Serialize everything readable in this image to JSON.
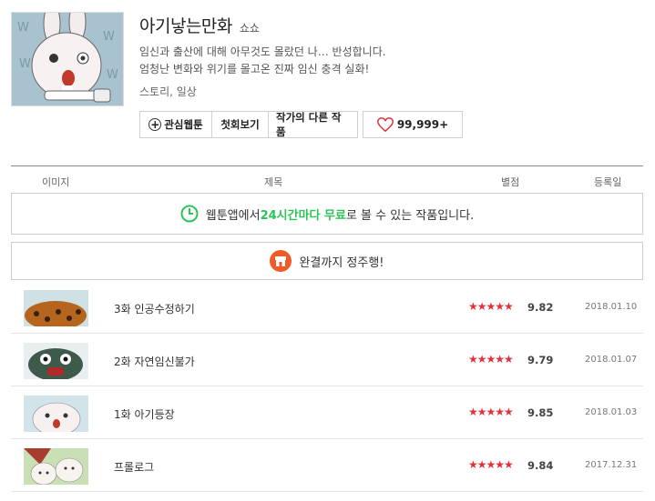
{
  "header": {
    "title": "아기낳는만화",
    "author": "쇼쇼",
    "description_line1": "임신과 출산에 대해 아무것도 몰랐던 나… 반성합니다.",
    "description_line2": "엄청난 변화와 위기를 몰고온 진짜 임신 충격 실화!",
    "genre": "스토리, 일상",
    "thumbnail_icon": "rabbit-brushing-teeth-illustration"
  },
  "buttons": {
    "favorite": "관심웹툰",
    "first_episode": "첫회보기",
    "other_works": "작가의 다른 작품",
    "likes": "99,999+"
  },
  "table": {
    "col_image": "이미지",
    "col_title": "제목",
    "col_rating": "별점",
    "col_date": "등록일"
  },
  "banners": {
    "free_pre": "웹툰앱에서 ",
    "free_highlight": "24시간마다 무료",
    "free_post": "로 볼 수 있는 작품입니다.",
    "complete": "완결까지 정주행!"
  },
  "episodes": [
    {
      "title": "3화 인공수정하기",
      "stars": "★★★★★",
      "score": "9.82",
      "date": "2018.01.10"
    },
    {
      "title": "2화 자연임신불가",
      "stars": "★★★★★",
      "score": "9.79",
      "date": "2018.01.07"
    },
    {
      "title": "1화 아기등장",
      "stars": "★★★★★",
      "score": "9.85",
      "date": "2018.01.03"
    },
    {
      "title": "프롤로그",
      "stars": "★★★★★",
      "score": "9.84",
      "date": "2017.12.31"
    }
  ],
  "colors": {
    "accent_green": "#2bc457",
    "star_red": "#e0323b",
    "heart_red": "#e0323b",
    "banner_icon_orange": "#f05a28"
  }
}
